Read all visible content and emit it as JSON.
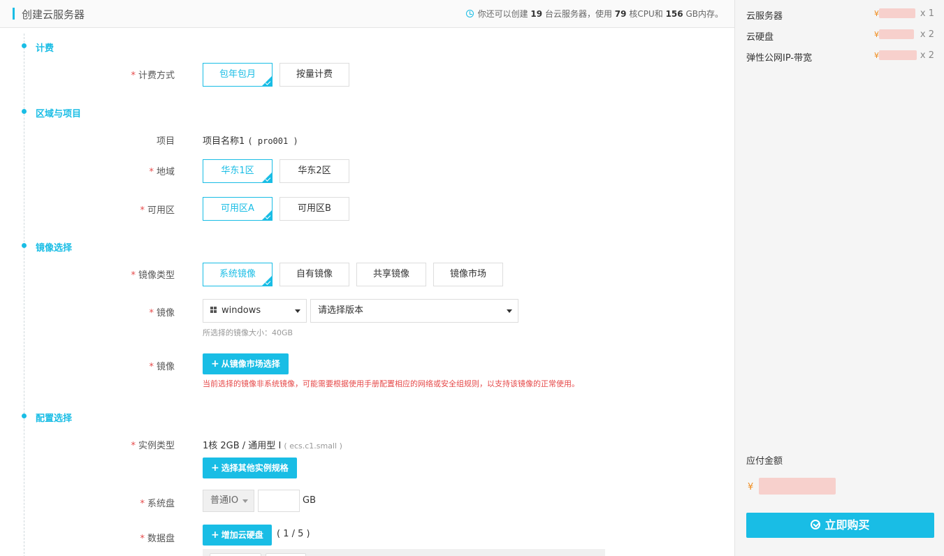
{
  "header": {
    "title": "创建云服务器",
    "quota": {
      "prefix": "你还可以创建",
      "servers": "19",
      "mid1": "台云服务器，使用",
      "cpu": "79",
      "mid2": "核CPU和",
      "mem": "156",
      "suffix": "GB内存。"
    }
  },
  "sections": {
    "billing": "计费",
    "region": "区域与项目",
    "image": "镜像选择",
    "config": "配置选择"
  },
  "billing": {
    "label": "计费方式",
    "options": [
      "包年包月",
      "按量计费"
    ],
    "selected": 0
  },
  "project": {
    "label": "项目",
    "value": "项目名称1",
    "code": "( pro001 )"
  },
  "region": {
    "label": "地域",
    "options": [
      "华东1区",
      "华东2区"
    ],
    "selected": 0
  },
  "zone": {
    "label": "可用区",
    "options": [
      "可用区A",
      "可用区B"
    ],
    "selected": 0
  },
  "image_type": {
    "label": "镜像类型",
    "options": [
      "系统镜像",
      "自有镜像",
      "共享镜像",
      "镜像市场"
    ],
    "selected": 0
  },
  "image": {
    "label": "镜像",
    "os_value": "windows",
    "version_placeholder": "请选择版本",
    "size_hint": "所选择的镜像大小：40GB"
  },
  "market": {
    "label": "镜像",
    "button": "从镜像市场选择",
    "warning": "当前选择的镜像非系统镜像，可能需要根据使用手册配置相应的网络或安全组规则，以支持该镜像的正常使用。"
  },
  "instance": {
    "label": "实例类型",
    "value": "1核 2GB / 通用型 I",
    "code": "( ecs.c1.small )",
    "button": "选择其他实例规格"
  },
  "system_disk": {
    "label": "系统盘",
    "type": "普通IO",
    "size": "",
    "unit": "GB"
  },
  "data_disk": {
    "label": "数据盘",
    "button": "增加云硬盘",
    "count": "( 1 / 5 )"
  },
  "summary": {
    "items": [
      {
        "name": "云服务器",
        "currency": "¥",
        "qty": "x 1"
      },
      {
        "name": "云硬盘",
        "currency": "¥",
        "qty": "x 2"
      },
      {
        "name": "弹性公网IP-带宽",
        "currency": "¥",
        "qty": "x 2"
      }
    ],
    "amount_label": "应付金额",
    "amount_currency": "¥",
    "buy_label": "立即购买"
  },
  "colors": {
    "accent": "#19bde5",
    "required": "#e64a4a",
    "price": "#f08c1e"
  },
  "icons": [
    "clock-icon",
    "check-icon",
    "windows-icon",
    "chevron-down-icon",
    "plus-icon",
    "cart-icon"
  ]
}
